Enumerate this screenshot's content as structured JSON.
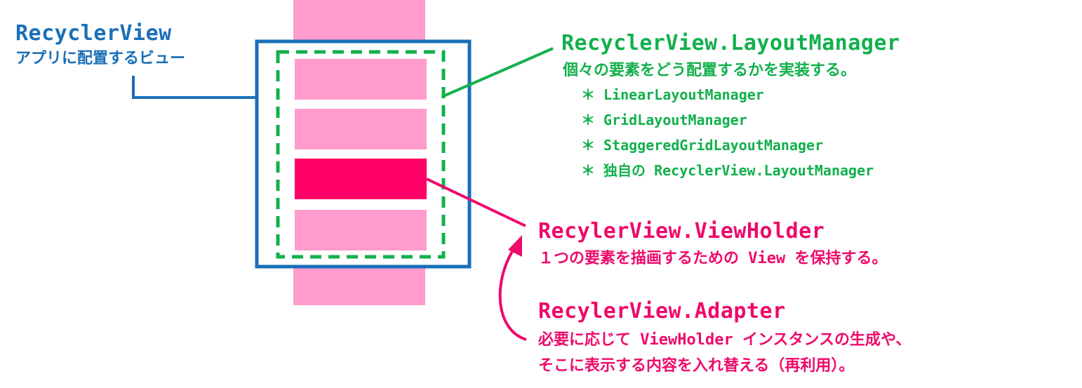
{
  "recycler_view": {
    "title": "RecyclerView",
    "desc": "アプリに配置するビュー"
  },
  "layout_manager": {
    "title": "RecyclerView.LayoutManager",
    "desc": "個々の要素をどう配置するかを実装する。",
    "items": [
      "＊ LinearLayoutManager",
      "＊ GridLayoutManager",
      "＊ StaggeredGridLayoutManager",
      "＊ 独自の RecyclerView.LayoutManager"
    ]
  },
  "view_holder": {
    "title": "RecylerView.ViewHolder",
    "desc": "１つの要素を描画するための View を保持する。"
  },
  "adapter": {
    "title": "RecylerView.Adapter",
    "desc_line1": "必要に応じて ViewHolder インスタンスの生成や、",
    "desc_line2": "そこに表示する内容を入れ替える（再利用）。"
  },
  "colors": {
    "recycler_view": "#1a6fb8",
    "layout_manager": "#12b04c",
    "view_holder": "#ee0a6a",
    "item": "#ff9ccd",
    "item_selected": "#ff0066"
  }
}
